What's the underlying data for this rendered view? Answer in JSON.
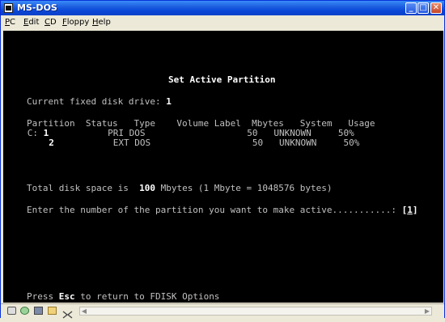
{
  "window": {
    "title": "MS-DOS"
  },
  "titlebar": {
    "minimize_glyph": "_",
    "maximize_glyph": "□",
    "close_glyph": "✕"
  },
  "menu": [
    "PC",
    "Edit",
    "CD",
    "Floppy",
    "Help"
  ],
  "console": {
    "heading": "Set Active Partition",
    "drive_label": "Current fixed disk drive:",
    "drive_value": "1",
    "table_header": "Partition  Status   Type    Volume Label  Mbytes   System   Usage",
    "rows": [
      {
        "drive": "C:",
        "num": "1",
        "rest": "           PRI DOS                   50   UNKNOWN     50%"
      },
      {
        "drive": "",
        "num": "2",
        "rest": "           EXT DOS                   50   UNKNOWN     50%"
      }
    ],
    "total_prefix": "Total disk space is  ",
    "total_value": "100",
    "total_suffix": " Mbytes (1 Mbyte = 1048576 bytes)",
    "prompt": "Enter the number of the partition you want to make active...........: ",
    "prompt_open": "[",
    "input_value": "1",
    "prompt_close": "]",
    "footer_prefix": "Press ",
    "footer_key": "Esc",
    "footer_suffix": " to return to FDISK Options"
  },
  "statusbar": {
    "icons": [
      "drive-a-icon",
      "cd-icon",
      "floppy-icon",
      "folder-icon",
      "settings-icon"
    ],
    "scroll_left_glyph": "◀",
    "scroll_right_glyph": "▶"
  }
}
